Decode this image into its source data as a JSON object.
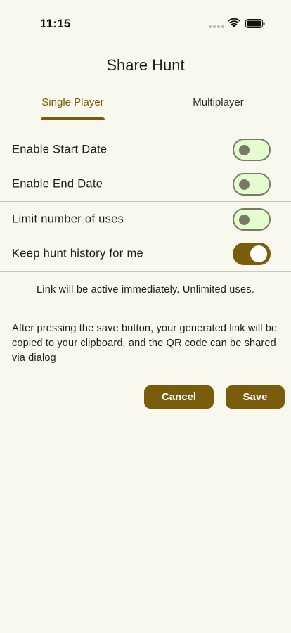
{
  "status_bar": {
    "time": "11:15"
  },
  "header": {
    "title": "Share Hunt"
  },
  "tabs": [
    {
      "label": "Single Player",
      "selected": true
    },
    {
      "label": "Multiplayer",
      "selected": false
    }
  ],
  "settings": [
    {
      "label": "Enable Start Date",
      "on": false
    },
    {
      "label": "Enable End Date",
      "on": false
    },
    {
      "label": "Limit number of uses",
      "on": false
    },
    {
      "label": "Keep hunt history for me",
      "on": true
    }
  ],
  "info_text": "Link will be active immediately. Unlimited uses.",
  "description": "After pressing the save button, your generated link will be copied to your clipboard, and the QR code can be shared via dialog",
  "buttons": {
    "cancel": "Cancel",
    "save": "Save"
  },
  "colors": {
    "background": "#f8f8ee",
    "accent": "#7a5d0c",
    "switch_off_track": "#e4fdd0",
    "switch_off_outline": "#7b7867"
  }
}
